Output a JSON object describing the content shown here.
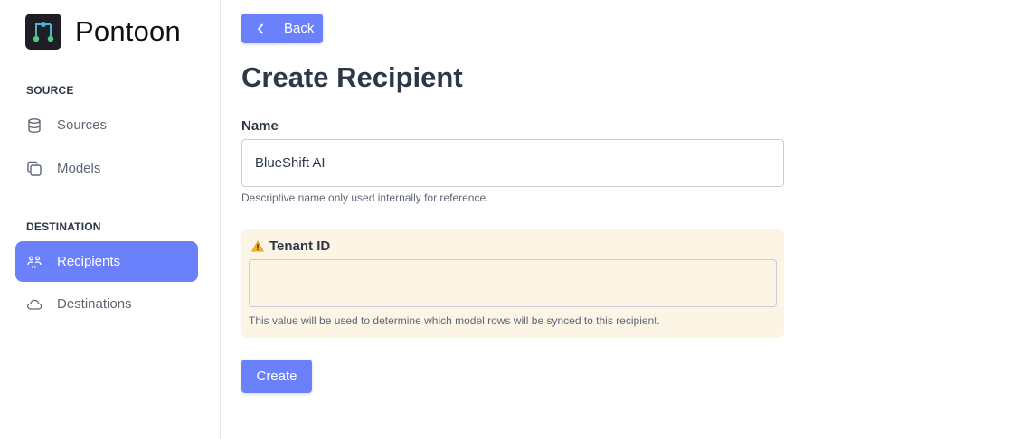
{
  "brand": {
    "name": "Pontoon",
    "logo_icon": "pontoon-logo-icon"
  },
  "sidebar": {
    "sections": [
      {
        "label": "SOURCE",
        "items": [
          {
            "label": "Sources",
            "icon": "database-icon",
            "active": false
          },
          {
            "label": "Models",
            "icon": "copy-icon",
            "active": false
          }
        ]
      },
      {
        "label": "DESTINATION",
        "items": [
          {
            "label": "Recipients",
            "icon": "users-icon",
            "active": true
          },
          {
            "label": "Destinations",
            "icon": "cloud-icon",
            "active": false
          }
        ]
      }
    ]
  },
  "main": {
    "back_button": {
      "label": "Back",
      "icon": "chevron-left-icon"
    },
    "title": "Create Recipient",
    "name_field": {
      "label": "Name",
      "value": "BlueShift AI",
      "help": "Descriptive name only used internally for reference."
    },
    "tenant_field": {
      "label": "Tenant ID",
      "icon": "warning-icon",
      "value": "",
      "help": "This value will be used to determine which model rows will be synced to this recipient."
    },
    "create_button": {
      "label": "Create"
    }
  },
  "colors": {
    "accent": "#6b80fb",
    "warning_bg": "#fcf5e6",
    "sidebar_border": "#e8e8ee",
    "text_dark": "#2d3748",
    "text_muted": "#5f6675"
  }
}
